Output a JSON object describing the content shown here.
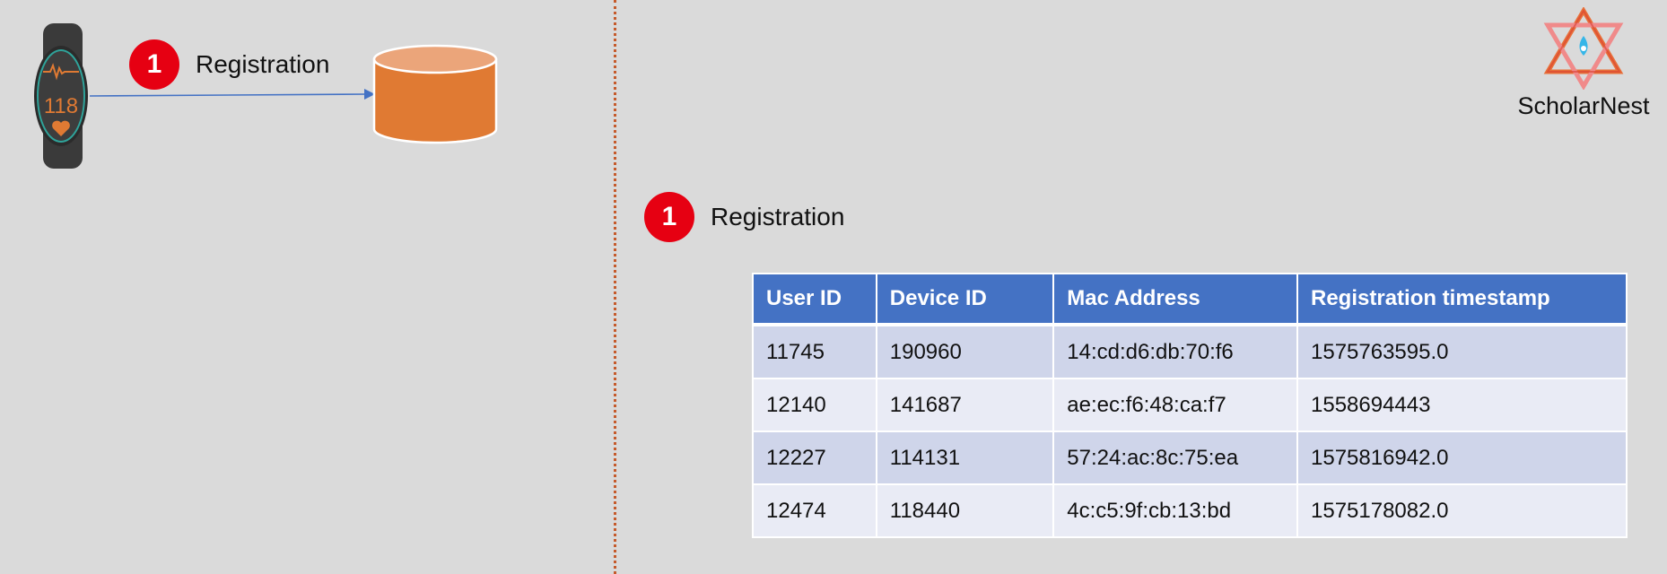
{
  "colors": {
    "background": "#dadada",
    "badge": "#e60012",
    "database": "#e07a33",
    "table_header": "#4472c4",
    "row_odd": "#cfd5ea",
    "row_even": "#e9ebf5",
    "divider": "#c55a2b",
    "arrow": "#4472c4"
  },
  "left_panel": {
    "step_number": "1",
    "step_label": "Registration",
    "watch_reading": "118",
    "icons": [
      "smartwatch-icon",
      "database-icon",
      "arrow-icon"
    ]
  },
  "right_panel": {
    "step_number": "1",
    "step_label": "Registration",
    "table": {
      "headers": [
        "User ID",
        "Device ID",
        "Mac Address",
        "Registration timestamp"
      ],
      "rows": [
        [
          "11745",
          "190960",
          "14:cd:d6:db:70:f6",
          "1575763595.0"
        ],
        [
          "12140",
          "141687",
          "ae:ec:f6:48:ca:f7",
          "1558694443"
        ],
        [
          "12227",
          "114131",
          "57:24:ac:8c:75:ea",
          "1575816942.0"
        ],
        [
          "12474",
          "118440",
          "4c:c5:9f:cb:13:bd",
          "1575178082.0"
        ]
      ]
    }
  },
  "brand": {
    "name": "ScholarNest",
    "icon": "scholarnest-logo-icon"
  }
}
